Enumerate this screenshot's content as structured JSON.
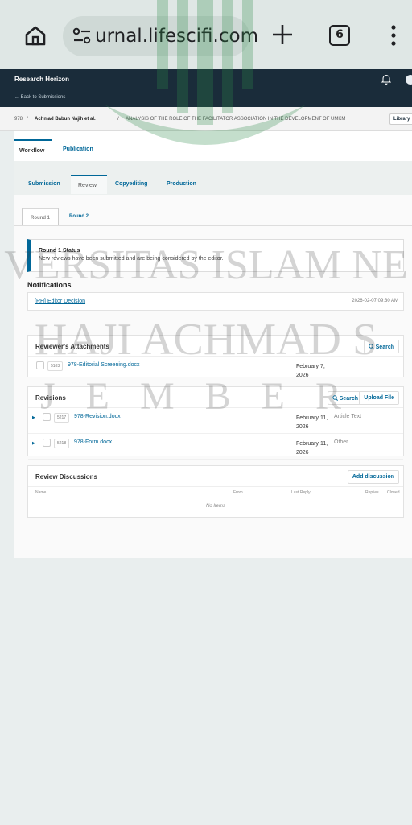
{
  "browser": {
    "url": "urnal.lifescifi.com",
    "tab_count": "6"
  },
  "header": {
    "site_title": "Research Horizon",
    "back_link": "← Back to Submissions"
  },
  "breadcrumb": {
    "id": "978",
    "sep": "/",
    "author": "Achmad Babun Najih et al.",
    "title": "ANALYSIS OF THE ROLE OF THE FACILITATOR ASSOCIATION IN THE DEVELOPMENT OF UMKM",
    "library": "Library"
  },
  "tabs": {
    "workflow": "Workflow",
    "publication": "Publication"
  },
  "stages": {
    "submission": "Submission",
    "review": "Review",
    "copyediting": "Copyediting",
    "production": "Production"
  },
  "rounds": {
    "round1": "Round 1",
    "round2": "Round 2"
  },
  "status": {
    "title": "Round 1 Status",
    "text": "New reviews have been submitted and are being considered by the editor."
  },
  "notifications": {
    "heading": "Notifications",
    "items": [
      {
        "label": "[RH] Editor Decision",
        "date": "2026-02-07 09:30 AM"
      }
    ]
  },
  "attachments": {
    "title": "Reviewer's Attachments",
    "search": "Search",
    "files": [
      {
        "id": "5103",
        "name": "978-Editorial Screening.docx",
        "date": "February 7, 2026"
      }
    ]
  },
  "revisions": {
    "title": "Revisions",
    "search": "Search",
    "upload": "Upload File",
    "files": [
      {
        "id": "5217",
        "name": "978-Revision.docx",
        "date": "February 11, 2026",
        "type": "Article Text"
      },
      {
        "id": "5218",
        "name": "978-Form.docx",
        "date": "February 11, 2026",
        "type": "Other"
      }
    ]
  },
  "discussions": {
    "title": "Review Discussions",
    "add": "Add discussion",
    "columns": {
      "name": "Name",
      "from": "From",
      "last_reply": "Last Reply",
      "replies": "Replies",
      "closed": "Closed"
    },
    "empty": "No Items"
  },
  "watermark": {
    "line1": "VERSITAS ISLAM NE",
    "line2": "HAJI ACHMAD S",
    "line3": "JEMBER"
  }
}
